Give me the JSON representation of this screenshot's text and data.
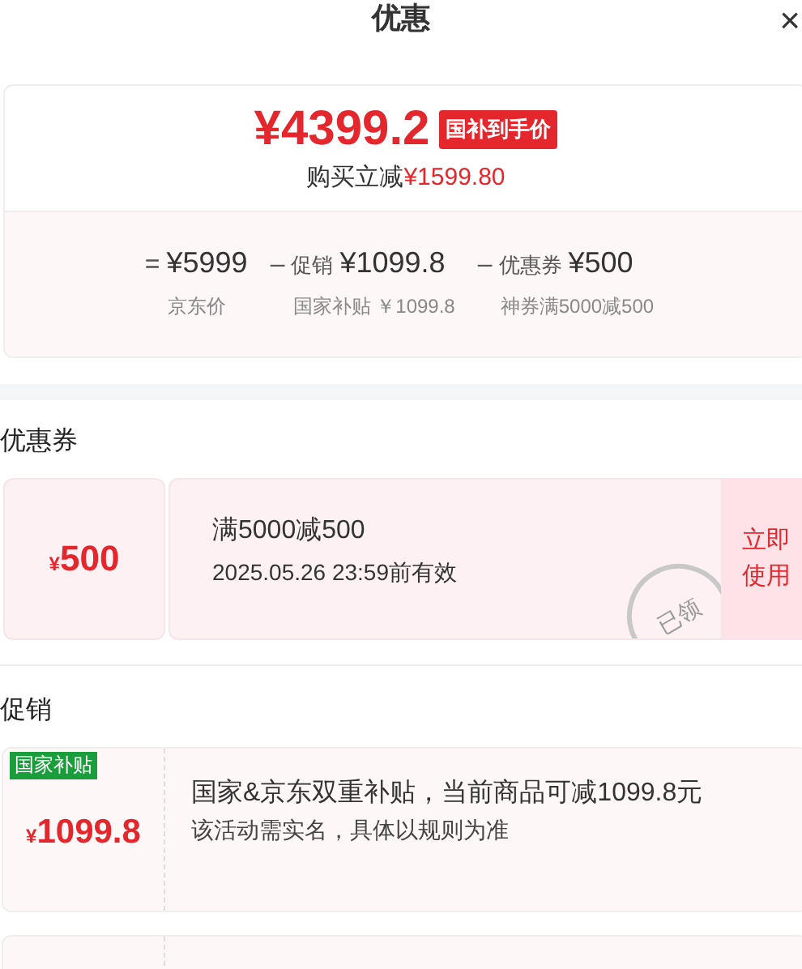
{
  "header": {
    "title": "优惠",
    "close": "×"
  },
  "summary": {
    "price": "¥4399.2",
    "badge": "国补到手价",
    "saving_label": "购买立减",
    "saving_amount": "¥1599.80",
    "breakdown": [
      {
        "op": "=",
        "amount": "¥5999",
        "note": "京东价"
      },
      {
        "op": "–",
        "label": "促销",
        "amount": "¥1099.8",
        "note": "国家补贴 ￥1099.8"
      },
      {
        "op": "–",
        "label": "优惠券",
        "amount": "¥500",
        "note": "神券满5000减500"
      }
    ]
  },
  "coupons": {
    "heading": "优惠券",
    "items": [
      {
        "currency": "¥",
        "amount": "500",
        "title": "满5000减500",
        "validity": "2025.05.26 23:59前有效",
        "stamp": "已领",
        "action": "立即使用"
      }
    ]
  },
  "promotions": {
    "heading": "促销",
    "items": [
      {
        "tag": "国家补贴",
        "currency": "¥",
        "amount": "1099.8",
        "title": "国家&京东双重补贴，当前商品可减1099.8元",
        "note": "该活动需实名，具体以规则为准"
      }
    ]
  }
}
